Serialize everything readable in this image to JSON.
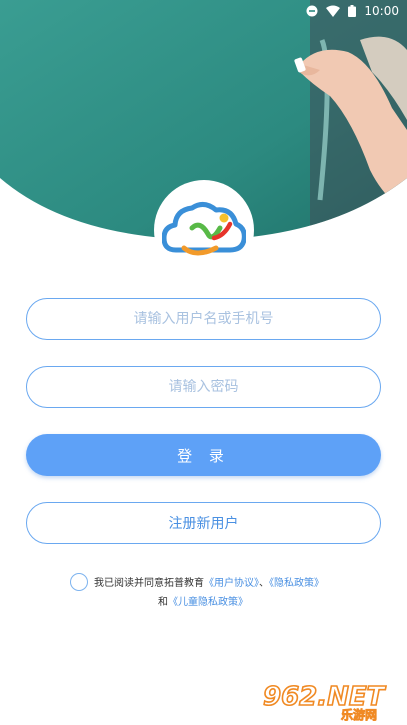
{
  "status_bar": {
    "time": "10:00",
    "icons": [
      "do-not-disturb-icon",
      "wifi-icon",
      "battery-icon"
    ]
  },
  "hero": {
    "description_icon": "classroom-chalkboard-photo"
  },
  "logo": {
    "icon": "cloud-logo-icon"
  },
  "form": {
    "username_placeholder": "请输入用户名或手机号",
    "username_value": "",
    "password_placeholder": "请输入密码",
    "password_value": "",
    "login_label": "登 录",
    "register_label": "注册新用户"
  },
  "agreement": {
    "checked": false,
    "prefix": "我已阅读并同意拓普教育",
    "user_agreement": "《用户协议》",
    "separator": "、",
    "privacy_policy": "《隐私政策》",
    "conjunction": "和",
    "child_privacy_policy": "《儿童隐私政策》"
  },
  "watermark": {
    "brand": "962.NET",
    "sub": "乐游网"
  },
  "colors": {
    "accent": "#5ea1f7",
    "border": "#6aa8f0",
    "link": "#4a90e2",
    "chalkboard": "#2f8f86"
  }
}
